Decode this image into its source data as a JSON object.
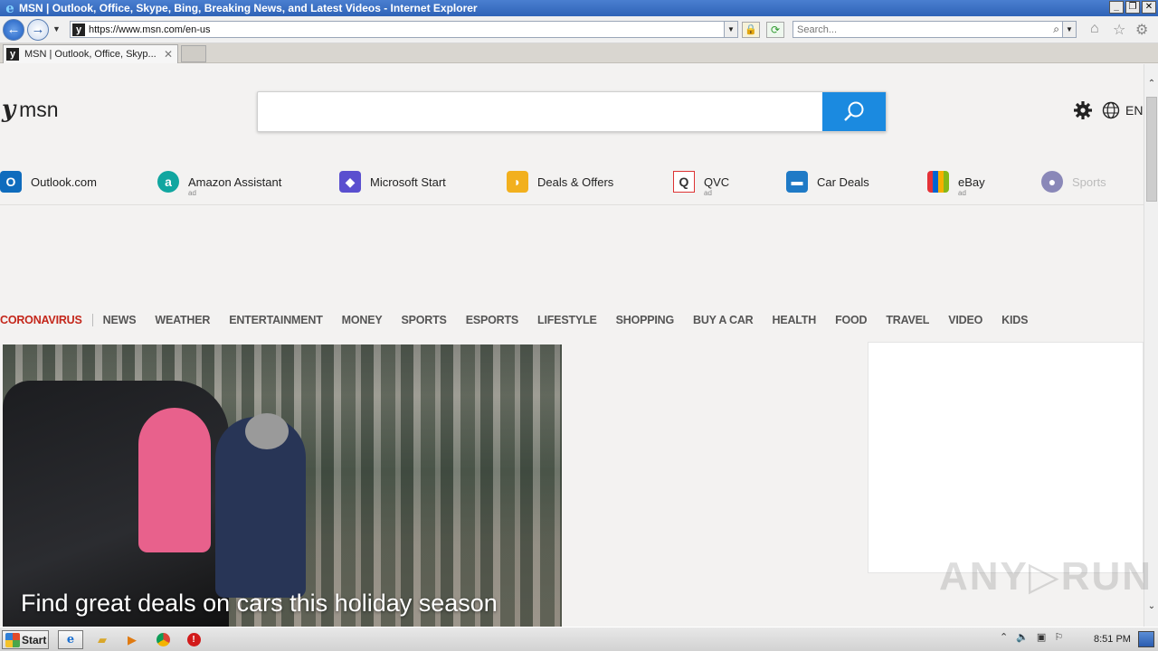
{
  "window": {
    "title": "MSN | Outlook, Office, Skype, Bing, Breaking News, and Latest Videos - Internet Explorer",
    "buttons": [
      "_",
      "❐",
      "✕"
    ]
  },
  "navbar": {
    "url": "https://www.msn.com/en-us",
    "search_placeholder": "Search..."
  },
  "tab": {
    "label": "MSN | Outlook, Office, Skyp...",
    "close": "✕"
  },
  "page": {
    "logo_text": "msn",
    "language": "EN",
    "quicklinks": [
      {
        "label": "Outlook.com",
        "ad": "",
        "icon": "outlook-icon",
        "color": "#0f6cbd",
        "glyph": "O"
      },
      {
        "label": "Amazon Assistant",
        "ad": "ad",
        "icon": "amazon-icon",
        "color": "#11a6a0",
        "glyph": "a"
      },
      {
        "label": "Microsoft Start",
        "ad": "",
        "icon": "microsoft-start-icon",
        "color": "#5a4fcf",
        "glyph": "◆"
      },
      {
        "label": "Deals & Offers",
        "ad": "",
        "icon": "deals-tag-icon",
        "color": "#f2b01e",
        "glyph": "◗"
      },
      {
        "label": "QVC",
        "ad": "ad",
        "icon": "qvc-icon",
        "color": "#ffffff",
        "glyph": "Q"
      },
      {
        "label": "Car Deals",
        "ad": "",
        "icon": "car-icon",
        "color": "#1f7ac6",
        "glyph": "🚙"
      },
      {
        "label": "eBay",
        "ad": "ad",
        "icon": "ebay-bag-icon",
        "color": "#111111",
        "glyph": "▦"
      },
      {
        "label": "Sports",
        "ad": "",
        "icon": "sports-ball-icon",
        "color": "#6a6aa8",
        "glyph": "⚽"
      }
    ],
    "nav": [
      "CORONAVIRUS",
      "NEWS",
      "WEATHER",
      "ENTERTAINMENT",
      "MONEY",
      "SPORTS",
      "ESPORTS",
      "LIFESTYLE",
      "SHOPPING",
      "BUY A CAR",
      "HEALTH",
      "FOOD",
      "TRAVEL",
      "VIDEO",
      "KIDS"
    ],
    "hero_caption": "Find great deals on cars this holiday season"
  },
  "watermark": "ANY▷RUN",
  "taskbar": {
    "start_label": "Start",
    "clock": "8:51 PM"
  },
  "colors": {
    "accent": "#1b8ae0",
    "nav_active": "#c4271b"
  }
}
